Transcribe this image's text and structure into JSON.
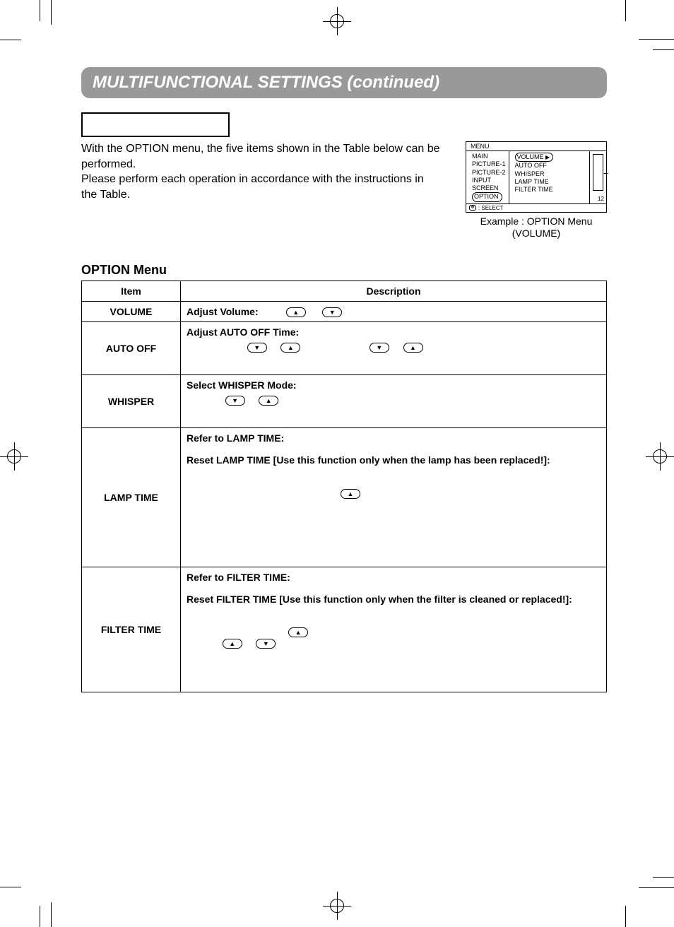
{
  "title": "MULTIFUNCTIONAL SETTINGS (continued)",
  "intro": {
    "p1": "With the OPTION menu, the five items shown in the Table below can be performed.",
    "p2": "Please perform each operation in accordance with the instructions in the Table."
  },
  "osd": {
    "menu_label": "MENU",
    "left": [
      "MAIN",
      "PICTURE-1",
      "PICTURE-2",
      "INPUT",
      "SCREEN",
      "OPTION"
    ],
    "right": [
      "VOLUME",
      "AUTO OFF",
      "WHISPER",
      "LAMP TIME",
      "FILTER TIME"
    ],
    "value": "12",
    "foot": ": SELECT",
    "caption_l1": "Example : OPTION Menu",
    "caption_l2": "(VOLUME)"
  },
  "section_heading": "OPTION Menu",
  "table": {
    "headers": {
      "item": "Item",
      "desc": "Description"
    },
    "rows": [
      {
        "item": "VOLUME",
        "desc": {
          "l1": "Adjust Volume:"
        }
      },
      {
        "item": "AUTO OFF",
        "desc": {
          "l1": "Adjust AUTO OFF Time:"
        }
      },
      {
        "item": "WHISPER",
        "desc": {
          "l1": "Select WHISPER Mode:"
        }
      },
      {
        "item": "LAMP TIME",
        "desc": {
          "l1": "Refer to LAMP TIME:",
          "l2": "Reset LAMP TIME  [Use this function only when the lamp has been replaced!]:"
        }
      },
      {
        "item": "FILTER TIME",
        "desc": {
          "l1": "Refer to FILTER TIME:",
          "l2": "Reset FILTER TIME [Use this function only when the filter is cleaned or replaced!]:"
        }
      }
    ]
  }
}
